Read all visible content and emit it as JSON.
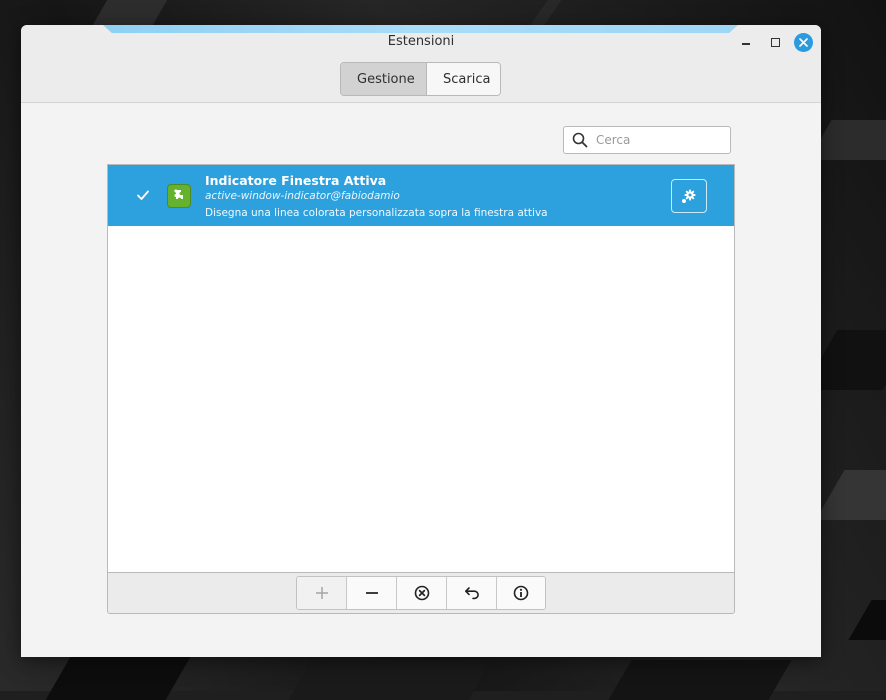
{
  "window": {
    "title": "Estensioni",
    "accent": "#2da0de"
  },
  "tabs": [
    {
      "label": "Gestione",
      "selected": true
    },
    {
      "label": "Scarica",
      "selected": false
    }
  ],
  "search": {
    "placeholder": "Cerca",
    "value": ""
  },
  "extensions": [
    {
      "name": "Indicatore Finestra Attiva",
      "uuid": "active-window-indicator@fabiodamio",
      "description": "Disegna una linea colorata personalizzata sopra la finestra attiva",
      "enabled": true,
      "selected": true,
      "icon": "puzzle-icon"
    }
  ],
  "toolbar": [
    {
      "icon": "plus-icon",
      "enabled": false
    },
    {
      "icon": "minus-icon",
      "enabled": true
    },
    {
      "icon": "uninstall-icon",
      "enabled": true
    },
    {
      "icon": "restore-icon",
      "enabled": true
    },
    {
      "icon": "info-icon",
      "enabled": true
    }
  ]
}
